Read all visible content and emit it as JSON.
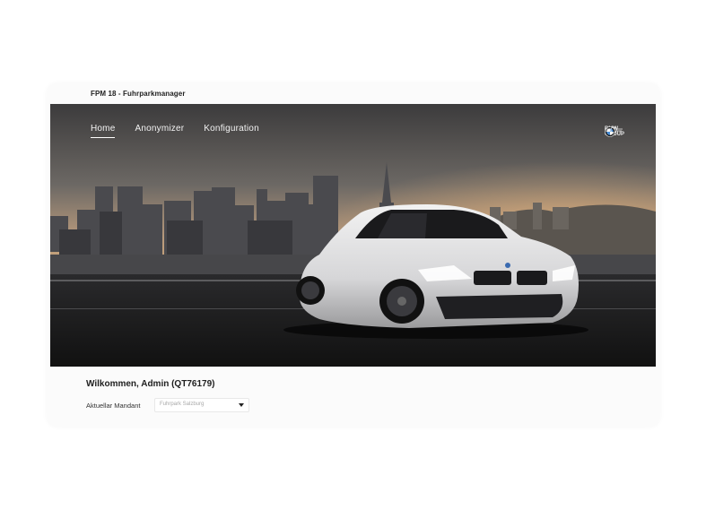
{
  "app": {
    "title": "FPM 18 - Fuhrparkmanager"
  },
  "nav": {
    "items": [
      {
        "label": "Home",
        "active": true
      },
      {
        "label": "Anonymizer",
        "active": false
      },
      {
        "label": "Konfiguration",
        "active": false
      }
    ]
  },
  "brand": {
    "line1": "BMW",
    "line2": "GROUP"
  },
  "welcome": {
    "text": "Wilkommen, Admin (QT76179)"
  },
  "mandant": {
    "label": "Aktuellar Mandant",
    "selected": "Fuhrpark Salzburg"
  },
  "colors": {
    "accent": "#ffffff",
    "text": "#1e1e1e",
    "card": "#fbfbfb"
  },
  "icons": [
    "bmw-roundel-icon",
    "mini-logo-icon",
    "chevron-down-icon"
  ]
}
